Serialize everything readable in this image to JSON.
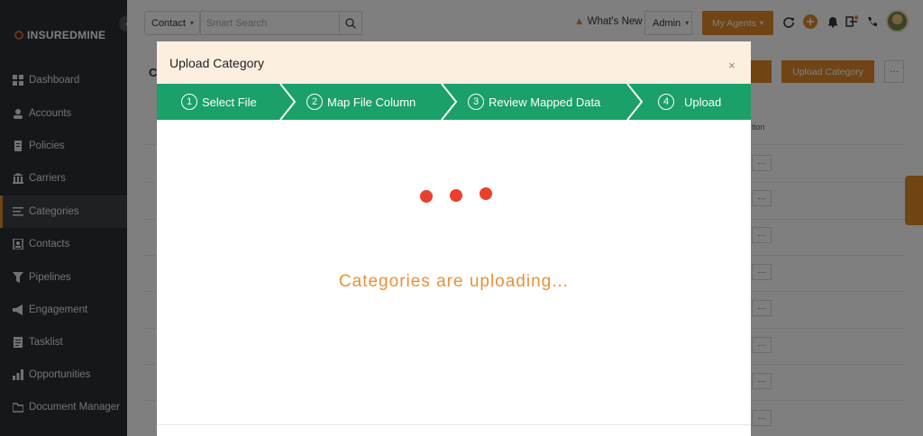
{
  "app": {
    "logo_text": "INSUREDMINE"
  },
  "sidebar": {
    "items": [
      {
        "label": "Dashboard",
        "icon": "dashboard-icon"
      },
      {
        "label": "Accounts",
        "icon": "accounts-icon"
      },
      {
        "label": "Policies",
        "icon": "policies-icon"
      },
      {
        "label": "Carriers",
        "icon": "carriers-icon"
      },
      {
        "label": "Categories",
        "icon": "categories-icon",
        "active": true
      },
      {
        "label": "Contacts",
        "icon": "contacts-icon"
      },
      {
        "label": "Pipelines",
        "icon": "pipelines-icon"
      },
      {
        "label": "Engagement",
        "icon": "engagement-icon"
      },
      {
        "label": "Tasklist",
        "icon": "tasklist-icon"
      },
      {
        "label": "Opportunities",
        "icon": "opportunities-icon"
      },
      {
        "label": "Document Manager",
        "icon": "document-manager-icon"
      }
    ]
  },
  "topbar": {
    "contact_select": "Contact",
    "search_placeholder": "Smart Search",
    "whats_new": "What's New",
    "admin_select": "Admin",
    "my_agents": "My Agents"
  },
  "page": {
    "title_initial": "C",
    "upload_category_button": "Upload Category",
    "more_button": "···",
    "column_header": "tion",
    "row_action": "···"
  },
  "modal": {
    "title": "Upload Category",
    "close": "×",
    "steps": [
      {
        "num": "1",
        "label": "Select File"
      },
      {
        "num": "2",
        "label": "Map File Column"
      },
      {
        "num": "3",
        "label": "Review Mapped Data"
      },
      {
        "num": "4",
        "label": "Upload"
      }
    ],
    "loading_text": "Categories are uploading..."
  },
  "colors": {
    "accent": "#e0892b",
    "stepper": "#1aa068",
    "loader": "#ea3f2c",
    "sidebar": "#283034"
  }
}
